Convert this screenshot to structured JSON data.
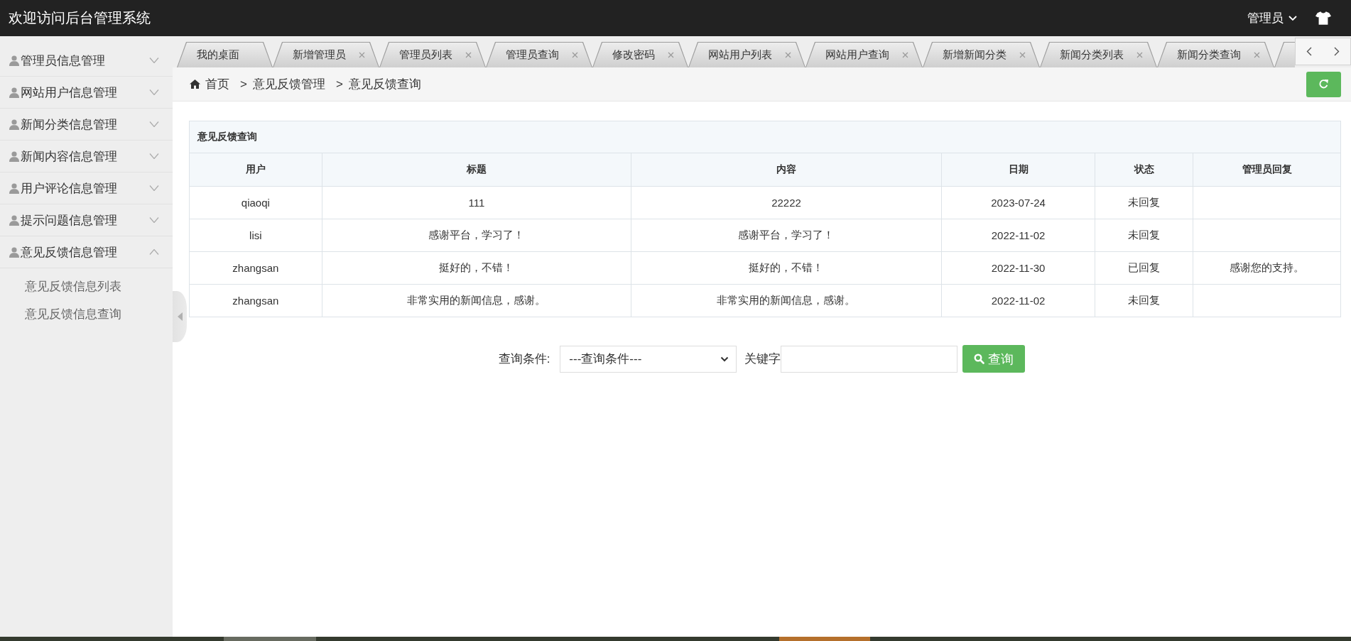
{
  "header": {
    "title": "欢迎访问后台管理系统",
    "user_menu": "管理员"
  },
  "sidebar": {
    "items": [
      {
        "label": "管理员信息管理",
        "expanded": false
      },
      {
        "label": "网站用户信息管理",
        "expanded": false
      },
      {
        "label": "新闻分类信息管理",
        "expanded": false
      },
      {
        "label": "新闻内容信息管理",
        "expanded": false
      },
      {
        "label": "用户评论信息管理",
        "expanded": false
      },
      {
        "label": "提示问题信息管理",
        "expanded": false
      },
      {
        "label": "意见反馈信息管理",
        "expanded": true,
        "children": [
          {
            "label": "意见反馈信息列表"
          },
          {
            "label": "意见反馈信息查询"
          }
        ]
      }
    ]
  },
  "tabs": [
    {
      "kind": "tab",
      "label": "我的桌面",
      "closable": false
    },
    {
      "kind": "tab",
      "label": "新增管理员",
      "closable": true
    },
    {
      "kind": "tab",
      "label": "管理员列表",
      "closable": true
    },
    {
      "kind": "tab",
      "label": "管理员查询",
      "closable": true
    },
    {
      "kind": "tab",
      "label": "修改密码",
      "closable": true
    },
    {
      "kind": "tab",
      "label": "网站用户列表",
      "closable": true
    },
    {
      "kind": "tab",
      "label": "网站用户查询",
      "closable": true
    },
    {
      "kind": "tab",
      "label": "新增新闻分类",
      "closable": true
    },
    {
      "kind": "tab",
      "label": "新闻分类列表",
      "closable": true
    },
    {
      "kind": "tab",
      "label": "新闻分类查询",
      "closable": true
    },
    {
      "kind": "cut"
    }
  ],
  "breadcrumb": [
    {
      "label": "首页"
    },
    {
      "separator": ">",
      "label": "意见反馈管理"
    },
    {
      "separator": ">",
      "label": "意见反馈查询"
    }
  ],
  "panel": {
    "title": "意见反馈查询",
    "table": {
      "columns": [
        "用户",
        "标题",
        "内容",
        "日期",
        "状态",
        "管理员回复"
      ],
      "rows": [
        {
          "user": "qiaoqi",
          "title": "111",
          "content": "22222",
          "date": "2023-07-24",
          "status": "未回复"
        },
        {
          "user": "lisi",
          "title": "感谢平台，学习了！",
          "content": "感谢平台，学习了！",
          "date": "2022-11-02",
          "status": "未回复"
        },
        {
          "user": "zhangsan",
          "title": "挺好的，不错！",
          "content": "挺好的，不错！",
          "date": "2022-11-30",
          "status": "已回复",
          "reply": "感谢您的支持。"
        },
        {
          "user": "zhangsan",
          "title": "非常实用的新闻信息，感谢。",
          "content": "非常实用的新闻信息，感谢。",
          "date": "2022-11-02",
          "status": "未回复"
        }
      ]
    }
  },
  "search": {
    "condition_label": "查询条件:",
    "condition_value": "---查询条件---",
    "keyword_label": "关键字",
    "button": "查询"
  }
}
